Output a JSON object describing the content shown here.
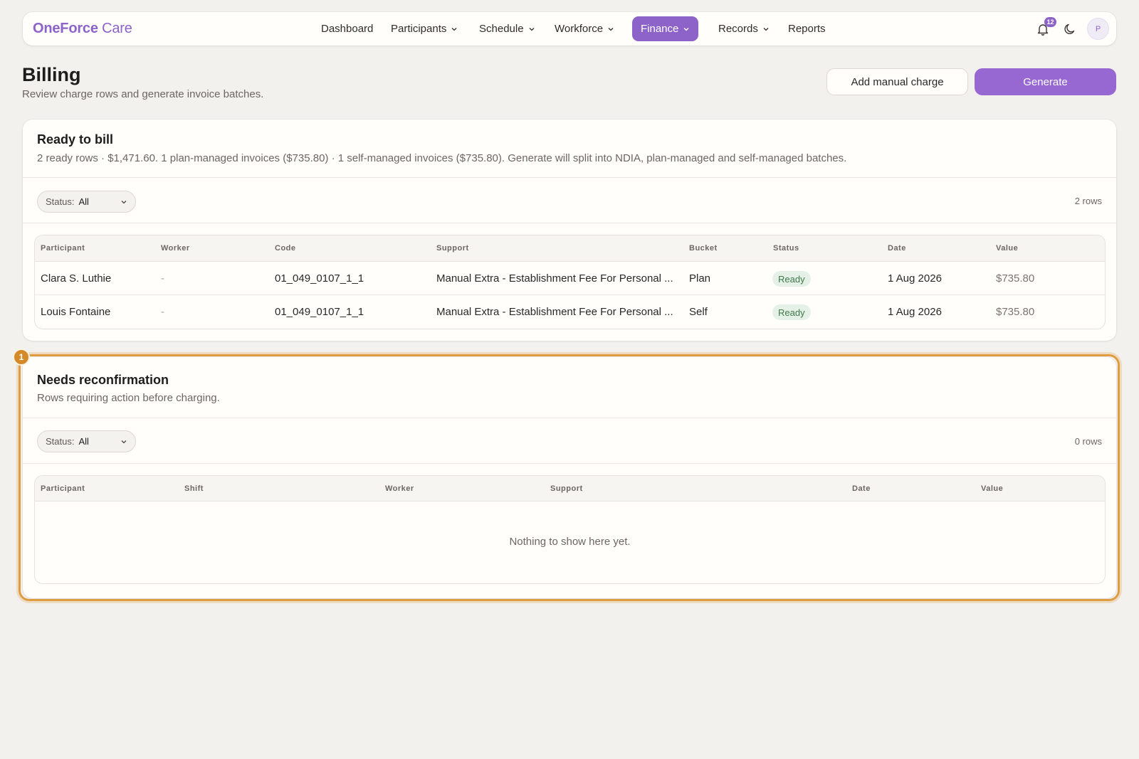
{
  "brand": {
    "name_bold": "OneForce",
    "name_light": " Care"
  },
  "nav": {
    "items": [
      {
        "label": "Dashboard",
        "dropdown": false
      },
      {
        "label": "Participants",
        "dropdown": true
      },
      {
        "label": "Schedule",
        "dropdown": true
      },
      {
        "label": "Workforce",
        "dropdown": true
      },
      {
        "label": "Finance",
        "dropdown": true,
        "active": true
      },
      {
        "label": "Records",
        "dropdown": true
      },
      {
        "label": "Reports",
        "dropdown": false
      }
    ],
    "notifications_count": "12",
    "avatar_initial": "P"
  },
  "page": {
    "title": "Billing",
    "subtitle": "Review charge rows and generate invoice batches.",
    "add_manual_charge": "Add manual charge",
    "generate": "Generate"
  },
  "ready": {
    "title": "Ready to bill",
    "description": "2 ready rows · $1,471.60. 1 plan-managed invoices ($735.80) · 1 self-managed invoices ($735.80). Generate will split into NDIA, plan-managed and self-managed batches.",
    "filter_label": "Status:",
    "filter_value": "All",
    "row_count": "2 rows",
    "columns": [
      "Participant",
      "Worker",
      "Code",
      "Support",
      "Bucket",
      "Status",
      "Date",
      "Value"
    ],
    "rows": [
      {
        "participant": "Clara S. Luthie",
        "worker": "-",
        "code": "01_049_0107_1_1",
        "support": "Manual Extra - Establishment Fee For Personal ...",
        "bucket": "Plan",
        "status": "Ready",
        "date": "1 Aug 2026",
        "value": "$735.80"
      },
      {
        "participant": "Louis Fontaine",
        "worker": "-",
        "code": "01_049_0107_1_1",
        "support": "Manual Extra - Establishment Fee For Personal ...",
        "bucket": "Self",
        "status": "Ready",
        "date": "1 Aug 2026",
        "value": "$735.80"
      }
    ]
  },
  "reconfirm": {
    "marker": "1",
    "title": "Needs reconfirmation",
    "description": "Rows requiring action before charging.",
    "filter_label": "Status:",
    "filter_value": "All",
    "row_count": "0 rows",
    "columns": [
      "Participant",
      "Shift",
      "Worker",
      "Support",
      "Date",
      "Value"
    ],
    "empty_text": "Nothing to show here yet."
  },
  "colors": {
    "accent": "#9767d2",
    "highlight": "#e09c40",
    "ready_bg": "#e5f0e7",
    "ready_text": "#3f7a4c"
  }
}
